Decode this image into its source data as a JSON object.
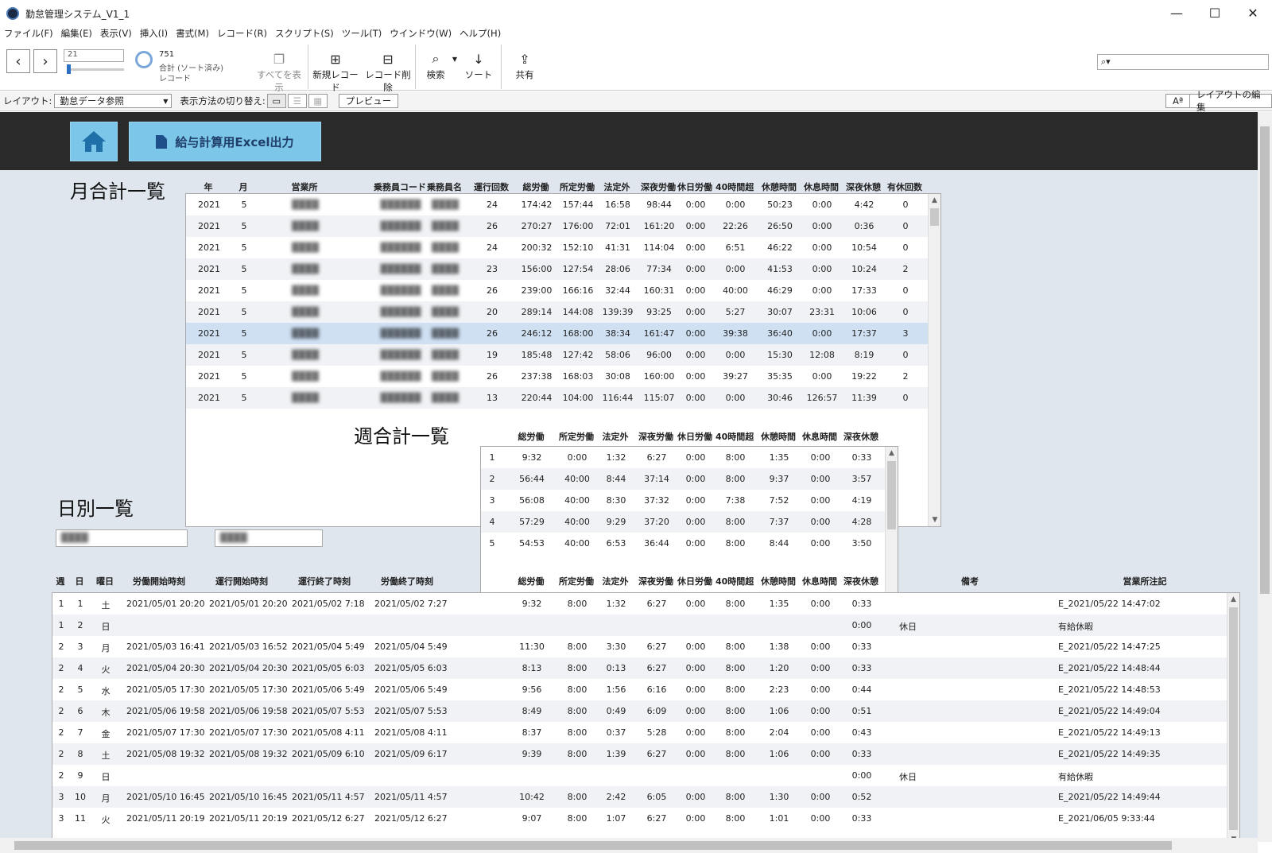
{
  "app": {
    "title": "勤怠管理システム_V1_1"
  },
  "window_controls": {
    "minimize": "—",
    "maximize": "☐",
    "close": "✕"
  },
  "menu": [
    "ファイル(F)",
    "編集(E)",
    "表示(V)",
    "挿入(I)",
    "書式(M)",
    "レコード(R)",
    "スクリプト(S)",
    "ツール(T)",
    "ウインドウ(W)",
    "ヘルプ(H)"
  ],
  "toolbar": {
    "record_field": "21",
    "total_count": "751",
    "total_label": "合計 (ソート済み)",
    "record_label": "レコード",
    "show_all": "すべてを表示",
    "new_record": "新規レコード",
    "delete_record": "レコード削除",
    "search": "検索",
    "sort": "ソート",
    "share": "共有"
  },
  "layoutbar": {
    "layout_label": "レイアウト:",
    "layout_value": "勤怠データ参照",
    "view_switch_label": "表示方法の切り替え:",
    "preview": "プレビュー",
    "font_btn": "Aª",
    "edit_layout": "レイアウトの編集"
  },
  "header_buttons": {
    "excel": "給与計算用Excel出力"
  },
  "monthly": {
    "title": "月合計一覧",
    "columns": [
      "年",
      "月",
      "営業所",
      "乗務員コード",
      "乗務員名",
      "運行回数",
      "総労働",
      "所定労働",
      "法定外",
      "深夜労働",
      "休日労働",
      "40時間超",
      "休憩時間",
      "休息時間",
      "深夜休憩",
      "有休回数"
    ],
    "rows": [
      [
        "2021",
        "5",
        "████",
        "██████",
        "████",
        "24",
        "174:42",
        "157:44",
        "16:58",
        "98:44",
        "0:00",
        "0:00",
        "50:23",
        "0:00",
        "4:42",
        "0"
      ],
      [
        "2021",
        "5",
        "████",
        "██████",
        "████",
        "26",
        "270:27",
        "176:00",
        "72:01",
        "161:20",
        "0:00",
        "22:26",
        "26:50",
        "0:00",
        "0:36",
        "0"
      ],
      [
        "2021",
        "5",
        "████",
        "██████",
        "████",
        "24",
        "200:32",
        "152:10",
        "41:31",
        "114:04",
        "0:00",
        "6:51",
        "46:22",
        "0:00",
        "10:54",
        "0"
      ],
      [
        "2021",
        "5",
        "████",
        "██████",
        "████",
        "23",
        "156:00",
        "127:54",
        "28:06",
        "77:34",
        "0:00",
        "0:00",
        "41:53",
        "0:00",
        "10:24",
        "2"
      ],
      [
        "2021",
        "5",
        "████",
        "██████",
        "████",
        "26",
        "239:00",
        "166:16",
        "32:44",
        "160:31",
        "0:00",
        "40:00",
        "46:29",
        "0:00",
        "17:33",
        "0"
      ],
      [
        "2021",
        "5",
        "████",
        "██████",
        "████",
        "20",
        "289:14",
        "144:08",
        "139:39",
        "93:25",
        "0:00",
        "5:27",
        "30:07",
        "23:31",
        "10:06",
        "0"
      ],
      [
        "2021",
        "5",
        "████",
        "██████",
        "████",
        "26",
        "246:12",
        "168:00",
        "38:34",
        "161:47",
        "0:00",
        "39:38",
        "36:40",
        "0:00",
        "17:37",
        "3"
      ],
      [
        "2021",
        "5",
        "████",
        "██████",
        "████",
        "19",
        "185:48",
        "127:42",
        "58:06",
        "96:00",
        "0:00",
        "0:00",
        "15:30",
        "12:08",
        "8:19",
        "0"
      ],
      [
        "2021",
        "5",
        "████",
        "██████",
        "████",
        "26",
        "237:38",
        "168:03",
        "30:08",
        "160:00",
        "0:00",
        "39:27",
        "35:35",
        "0:00",
        "19:22",
        "2"
      ],
      [
        "2021",
        "5",
        "████",
        "██████",
        "████",
        "13",
        "220:44",
        "104:00",
        "116:44",
        "115:07",
        "0:00",
        "0:00",
        "30:46",
        "126:57",
        "11:39",
        "0"
      ]
    ]
  },
  "weekly": {
    "title": "週合計一覧",
    "columns": [
      "総労働",
      "所定労働",
      "法定外",
      "深夜労働",
      "休日労働",
      "40時間超",
      "休憩時間",
      "休息時間",
      "深夜休憩"
    ],
    "rows": [
      [
        "1",
        "9:32",
        "0:00",
        "1:32",
        "6:27",
        "0:00",
        "8:00",
        "1:35",
        "0:00",
        "0:33"
      ],
      [
        "2",
        "56:44",
        "40:00",
        "8:44",
        "37:14",
        "0:00",
        "8:00",
        "9:37",
        "0:00",
        "3:57"
      ],
      [
        "3",
        "56:08",
        "40:00",
        "8:30",
        "37:32",
        "0:00",
        "7:38",
        "7:52",
        "0:00",
        "4:19"
      ],
      [
        "4",
        "57:29",
        "40:00",
        "9:29",
        "37:20",
        "0:00",
        "8:00",
        "7:37",
        "0:00",
        "4:28"
      ],
      [
        "5",
        "54:53",
        "40:00",
        "6:53",
        "36:44",
        "0:00",
        "8:00",
        "8:44",
        "0:00",
        "3:50"
      ]
    ]
  },
  "daily": {
    "title": "日別一覧",
    "filter1": "████",
    "filter2": "████",
    "columns": [
      "週",
      "日",
      "曜日",
      "労働開始時刻",
      "運行開始時刻",
      "運行終了時刻",
      "労働終了時刻",
      "総労働",
      "所定労働",
      "法定外",
      "深夜労働",
      "休日労働",
      "40時間超",
      "休憩時間",
      "休息時間",
      "深夜休憩",
      "備考",
      "営業所注記"
    ],
    "rows": [
      [
        "1",
        "1",
        "土",
        "2021/05/01 20:20",
        "2021/05/01 20:20",
        "2021/05/02 7:18",
        "2021/05/02 7:27",
        "9:32",
        "8:00",
        "1:32",
        "6:27",
        "0:00",
        "8:00",
        "1:35",
        "0:00",
        "0:33",
        "",
        "E_2021/05/22 14:47:02"
      ],
      [
        "1",
        "2",
        "日",
        "",
        "",
        "",
        "",
        "",
        "",
        "",
        "",
        "",
        "",
        "",
        "",
        "0:00",
        "休日",
        "有給休暇"
      ],
      [
        "2",
        "3",
        "月",
        "2021/05/03 16:41",
        "2021/05/03 16:52",
        "2021/05/04 5:49",
        "2021/05/04 5:49",
        "11:30",
        "8:00",
        "3:30",
        "6:27",
        "0:00",
        "8:00",
        "1:38",
        "0:00",
        "0:33",
        "",
        "E_2021/05/22 14:47:25"
      ],
      [
        "2",
        "4",
        "火",
        "2021/05/04 20:30",
        "2021/05/04 20:30",
        "2021/05/05 6:03",
        "2021/05/05 6:03",
        "8:13",
        "8:00",
        "0:13",
        "6:27",
        "0:00",
        "8:00",
        "1:20",
        "0:00",
        "0:33",
        "",
        "E_2021/05/22 14:48:44"
      ],
      [
        "2",
        "5",
        "水",
        "2021/05/05 17:30",
        "2021/05/05 17:30",
        "2021/05/06 5:49",
        "2021/05/06 5:49",
        "9:56",
        "8:00",
        "1:56",
        "6:16",
        "0:00",
        "8:00",
        "2:23",
        "0:00",
        "0:44",
        "",
        "E_2021/05/22 14:48:53"
      ],
      [
        "2",
        "6",
        "木",
        "2021/05/06 19:58",
        "2021/05/06 19:58",
        "2021/05/07 5:53",
        "2021/05/07 5:53",
        "8:49",
        "8:00",
        "0:49",
        "6:09",
        "0:00",
        "8:00",
        "1:06",
        "0:00",
        "0:51",
        "",
        "E_2021/05/22 14:49:04"
      ],
      [
        "2",
        "7",
        "金",
        "2021/05/07 17:30",
        "2021/05/07 17:30",
        "2021/05/08 4:11",
        "2021/05/08 4:11",
        "8:37",
        "8:00",
        "0:37",
        "5:28",
        "0:00",
        "8:00",
        "2:04",
        "0:00",
        "0:43",
        "",
        "E_2021/05/22 14:49:13"
      ],
      [
        "2",
        "8",
        "土",
        "2021/05/08 19:32",
        "2021/05/08 19:32",
        "2021/05/09 6:10",
        "2021/05/09 6:17",
        "9:39",
        "8:00",
        "1:39",
        "6:27",
        "0:00",
        "8:00",
        "1:06",
        "0:00",
        "0:33",
        "",
        "E_2021/05/22 14:49:35"
      ],
      [
        "2",
        "9",
        "日",
        "",
        "",
        "",
        "",
        "",
        "",
        "",
        "",
        "",
        "",
        "",
        "",
        "0:00",
        "休日",
        "有給休暇"
      ],
      [
        "3",
        "10",
        "月",
        "2021/05/10 16:45",
        "2021/05/10 16:45",
        "2021/05/11 4:57",
        "2021/05/11 4:57",
        "10:42",
        "8:00",
        "2:42",
        "6:05",
        "0:00",
        "8:00",
        "1:30",
        "0:00",
        "0:52",
        "",
        "E_2021/05/22 14:49:44"
      ],
      [
        "3",
        "11",
        "火",
        "2021/05/11 20:19",
        "2021/05/11 20:19",
        "2021/05/12 6:27",
        "2021/05/12 6:27",
        "9:07",
        "8:00",
        "1:07",
        "6:27",
        "0:00",
        "8:00",
        "1:01",
        "0:00",
        "0:33",
        "",
        "E_2021/06/05 9:33:44"
      ]
    ]
  }
}
